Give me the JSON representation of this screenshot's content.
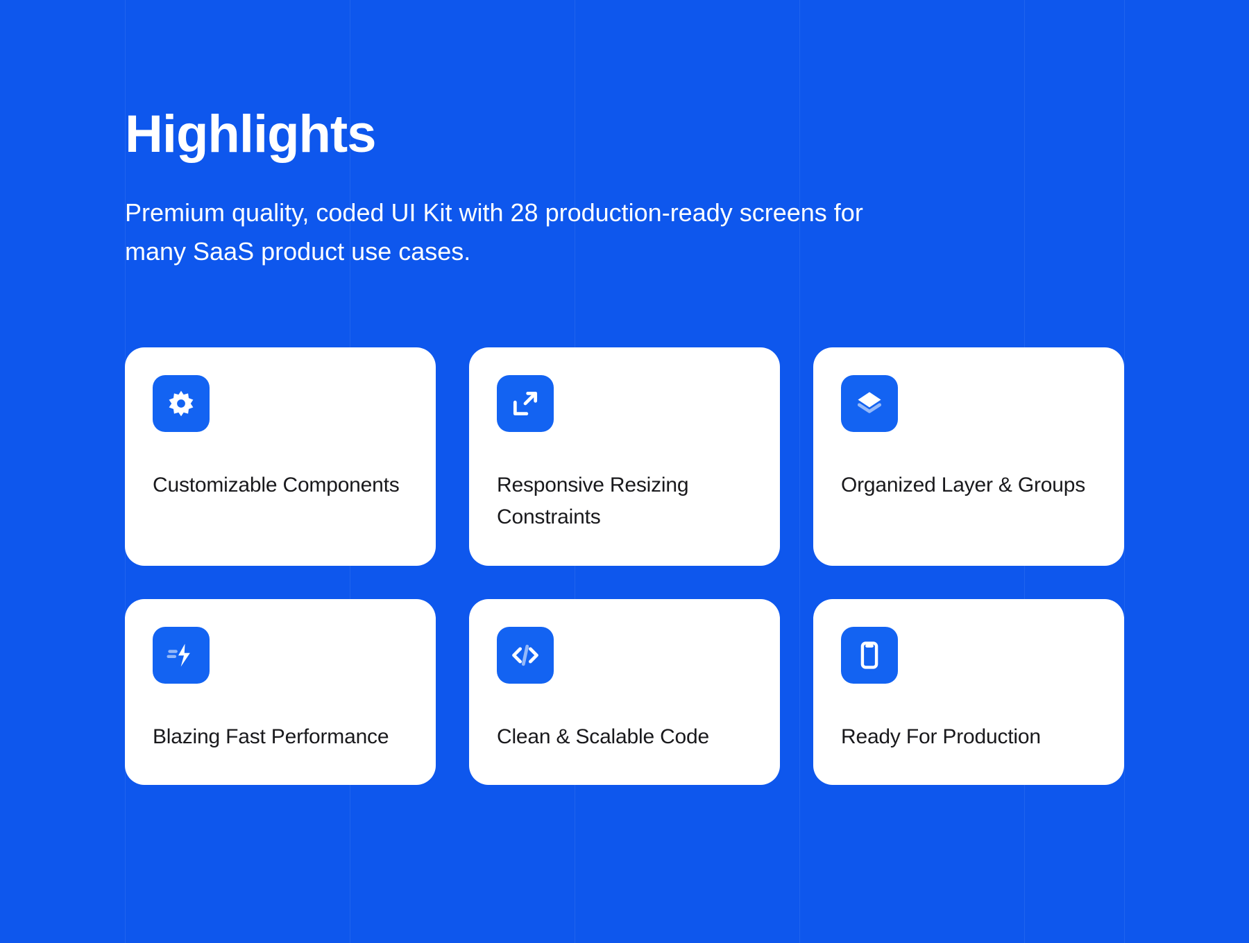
{
  "colors": {
    "bg": "#0E57ED",
    "icon_bg": "#1363F2",
    "card_bg": "#FFFFFF",
    "text_dark": "#19191C"
  },
  "header": {
    "title": "Highlights",
    "subtitle": "Premium quality, coded UI Kit with 28 production-ready screens for many SaaS product use cases."
  },
  "cards": [
    {
      "icon": "brightness-icon",
      "title": "Customizable Components"
    },
    {
      "icon": "resize-icon",
      "title": "Responsive Resizing Constraints"
    },
    {
      "icon": "layers-icon",
      "title": "Organized Layer & Groups"
    },
    {
      "icon": "bolt-icon",
      "title": "Blazing Fast Performance"
    },
    {
      "icon": "code-icon",
      "title": "Clean & Scalable Code"
    },
    {
      "icon": "phone-icon",
      "title": "Ready For Production"
    }
  ]
}
